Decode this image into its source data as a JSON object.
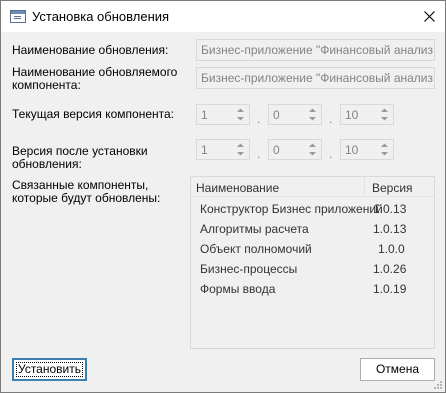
{
  "window": {
    "title": "Установка обновления"
  },
  "form": {
    "update_name_label": "Наименование обновления:",
    "update_name_value": "Бизнес-приложение \"Финансовый анализ конт",
    "component_name_label": "Наименование обновляемого компонента:",
    "component_name_value": "Бизнес-приложение \"Финансовый анализ конт",
    "current_version_label": "Текущая версия компонента:",
    "current_version": {
      "major": "1",
      "minor": "0",
      "build": "10"
    },
    "new_version_label": "Версия после установки обновления:",
    "new_version": {
      "major": "1",
      "minor": "0",
      "build": "10"
    },
    "related_label": "Связанные компоненты, которые будут обновлены:",
    "separator": "."
  },
  "grid": {
    "columns": {
      "name": "Наименование",
      "version": "Версия"
    },
    "rows": [
      {
        "name": "Конструктор Бизнес приложений",
        "version": "1.0.13"
      },
      {
        "name": "Алгоритмы расчета",
        "version": "1.0.13"
      },
      {
        "name": "Объект полномочий",
        "version": "1.0.0"
      },
      {
        "name": "Бизнес-процессы",
        "version": "1.0.26"
      },
      {
        "name": "Формы ввода",
        "version": "1.0.19"
      }
    ]
  },
  "buttons": {
    "install": "Установить",
    "cancel": "Отмена"
  },
  "icons": {
    "app": "window-icon",
    "close": "close-icon",
    "spin": "spin-arrows-icon",
    "grip": "resize-grip-icon"
  },
  "colors": {
    "background": "#f0f0f0",
    "disabled_text": "#838383",
    "default_button_border": "#3c7fb1"
  }
}
